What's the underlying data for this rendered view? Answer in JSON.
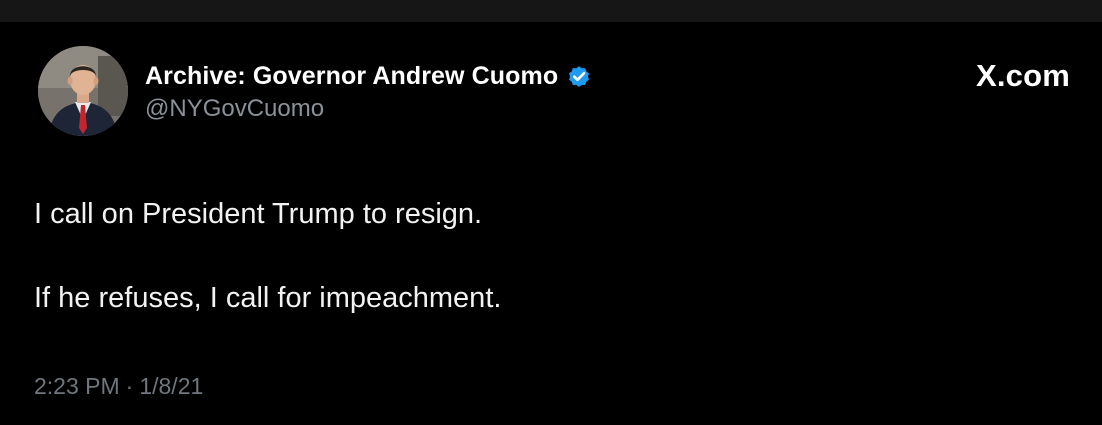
{
  "tweet": {
    "author": {
      "display_name": "Archive: Governor Andrew Cuomo",
      "handle": "@NYGovCuomo",
      "verified_icon": "verified-badge-icon",
      "verified_color": "#1d9bf0"
    },
    "site_label": "X.com",
    "paragraphs": [
      "I call on President Trump to resign.",
      "If he refuses, I call for impeachment."
    ],
    "time": "2:23 PM",
    "separator": "·",
    "date": "1/8/21"
  },
  "colors": {
    "background": "#000000",
    "top_strip": "#161616",
    "primary_text": "#ffffff",
    "secondary_text": "#8b9198"
  }
}
